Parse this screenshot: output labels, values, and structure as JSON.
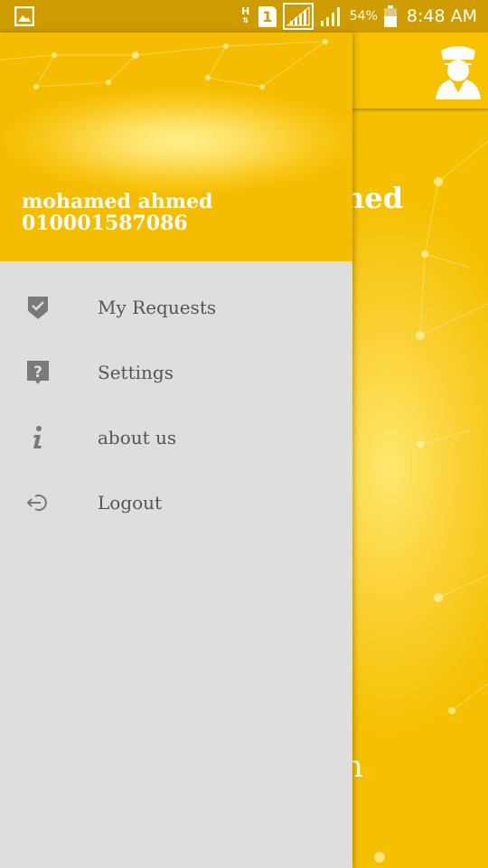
{
  "status_bar": {
    "network_type": "H",
    "sim_slot": "1",
    "battery_percent": "54%",
    "time": "8:48 AM"
  },
  "main": {
    "title_fragment": "ned",
    "bottom_fragment": "n"
  },
  "drawer": {
    "user_name": "mohamed ahmed",
    "user_phone": "010001587086",
    "items": [
      {
        "label": "My Requests",
        "icon": "shield-check-icon"
      },
      {
        "label": "Settings",
        "icon": "help-bubble-icon"
      },
      {
        "label": "about us",
        "icon": "info-icon"
      },
      {
        "label": "Logout",
        "icon": "logout-icon"
      }
    ]
  },
  "colors": {
    "accent": "#f7c100",
    "status_bar": "#cf9c00",
    "drawer_bg": "#dedede",
    "menu_text": "#555555",
    "icon_gray": "#7a7a7a"
  }
}
